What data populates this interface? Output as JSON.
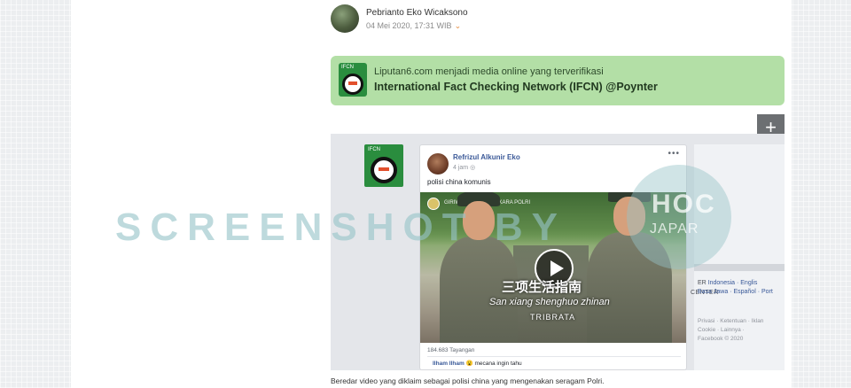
{
  "author": {
    "name": "Pebrianto Eko Wicaksono",
    "date": "04 Mei 2020, 17:31 WIB"
  },
  "banner": {
    "line1": "Liputan6.com menjadi media online yang terverifikasi",
    "line2": "International Fact Checking Network (IFCN) @Poynter"
  },
  "plus_label": "+",
  "fb_post": {
    "name": "Refrizul Alkunir Eko",
    "time": "4 jam",
    "text": "polisi china komunis",
    "menu": "•••",
    "video": {
      "header": "GIRIWOYO BHAYANGKARA POLRI",
      "subtitle_cn": "三项生活指南",
      "subtitle_pinyin": "San xiang shenghuo zhinan",
      "subtitle_word": "TRIBRATA"
    },
    "views": "184.683 Tayangan",
    "comment_name": "Ilham Ilham",
    "comment_emoji": "😮",
    "comment_text": "mecana ingin tahu"
  },
  "fb_sidebar": {
    "center_text": "CENTER",
    "lang_prefix": "ER",
    "languages_1": "Indonesia · Englis",
    "languages_2": "Basa Jawa · Español · Port",
    "footer_1": "Privasi · Ketentuan · Iklan",
    "footer_2": "Cookie · Lainnya ·",
    "footer_3": "Facebook © 2020"
  },
  "caption": "Beredar video yang diklaim sebagai polisi china yang mengenakan seragam Polri.",
  "watermark": {
    "text": "SCREENSHOT BY",
    "logo_main": "HOC",
    "logo_sub": "JAPAR"
  },
  "colors": {
    "banner_bg": "#b3dfa6",
    "fb_link": "#385898",
    "watermark": "#96c4c8"
  }
}
